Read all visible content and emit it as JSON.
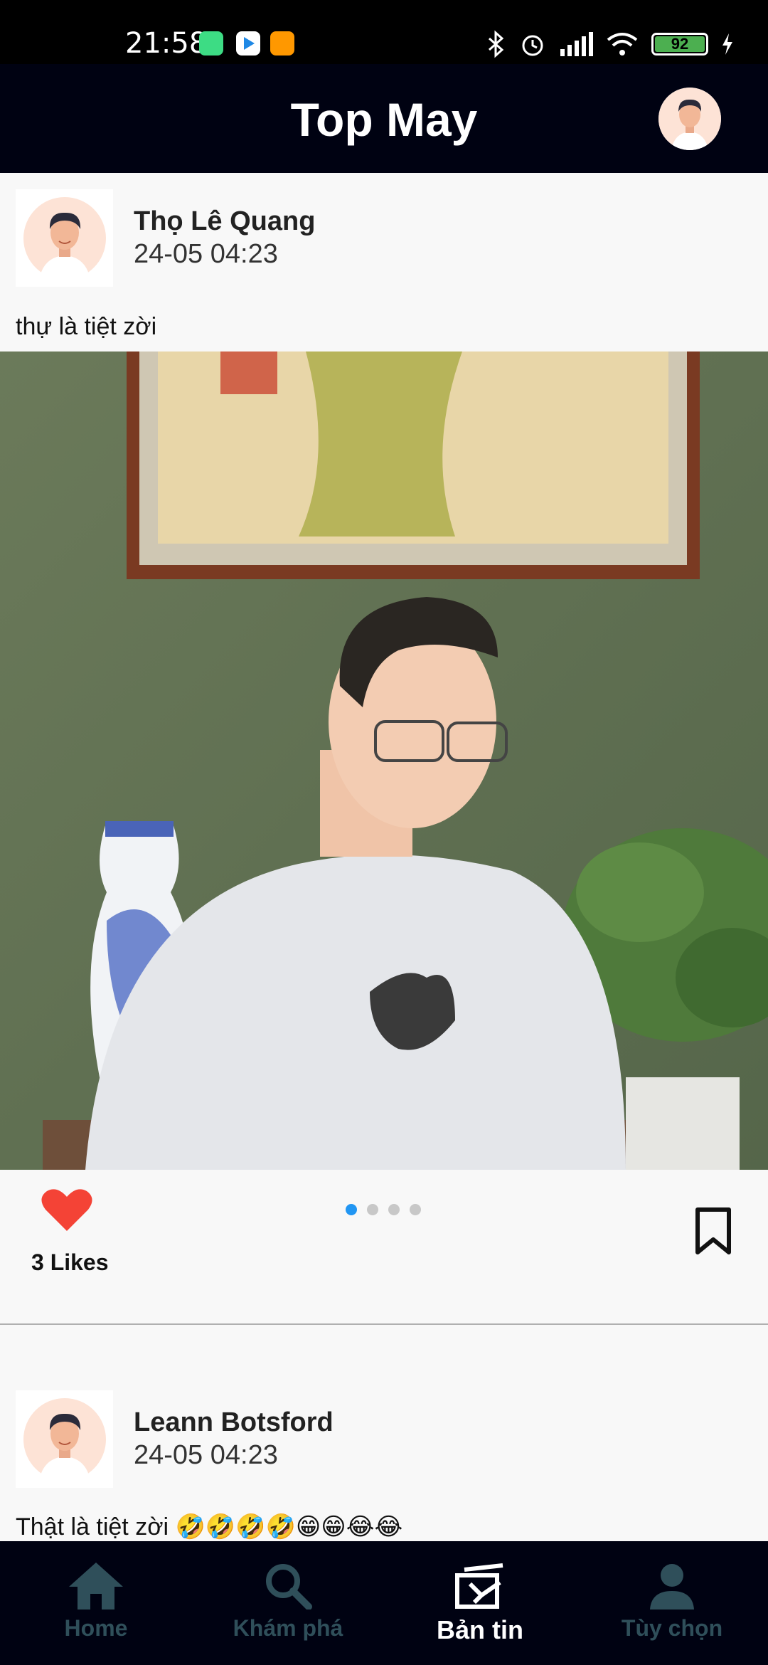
{
  "status_bar": {
    "time": "21:58",
    "battery": "92",
    "icons": [
      "android-icon",
      "play-store-icon",
      "app-notification-icon",
      "bluetooth-icon",
      "alarm-icon",
      "signal-icon",
      "wifi-icon",
      "battery-icon",
      "charging-icon"
    ]
  },
  "header": {
    "title": "Top May"
  },
  "posts": [
    {
      "author": "Thọ Lê Quang",
      "time": "24-05 04:23",
      "text": "thự là tiệt zời",
      "likes_label": "3 Likes",
      "image_count": 4,
      "active_image": 1
    },
    {
      "author": "Leann Botsford",
      "time": "24-05 04:23",
      "text": "Thật là tiệt zời 🤣🤣🤣🤣😁😁😂😂"
    }
  ],
  "bottom_nav": [
    {
      "label": "Home",
      "icon": "home-icon"
    },
    {
      "label": "Khám phá",
      "icon": "search-icon"
    },
    {
      "label": "Bản tin",
      "icon": "newsfeed-icon",
      "active": true
    },
    {
      "label": "Tùy chọn",
      "icon": "person-icon"
    }
  ],
  "colors": {
    "header_bg": "#000212",
    "like_red": "#f44336",
    "dot_active": "#2196f3",
    "nav_inactive": "#2f4f5a"
  }
}
